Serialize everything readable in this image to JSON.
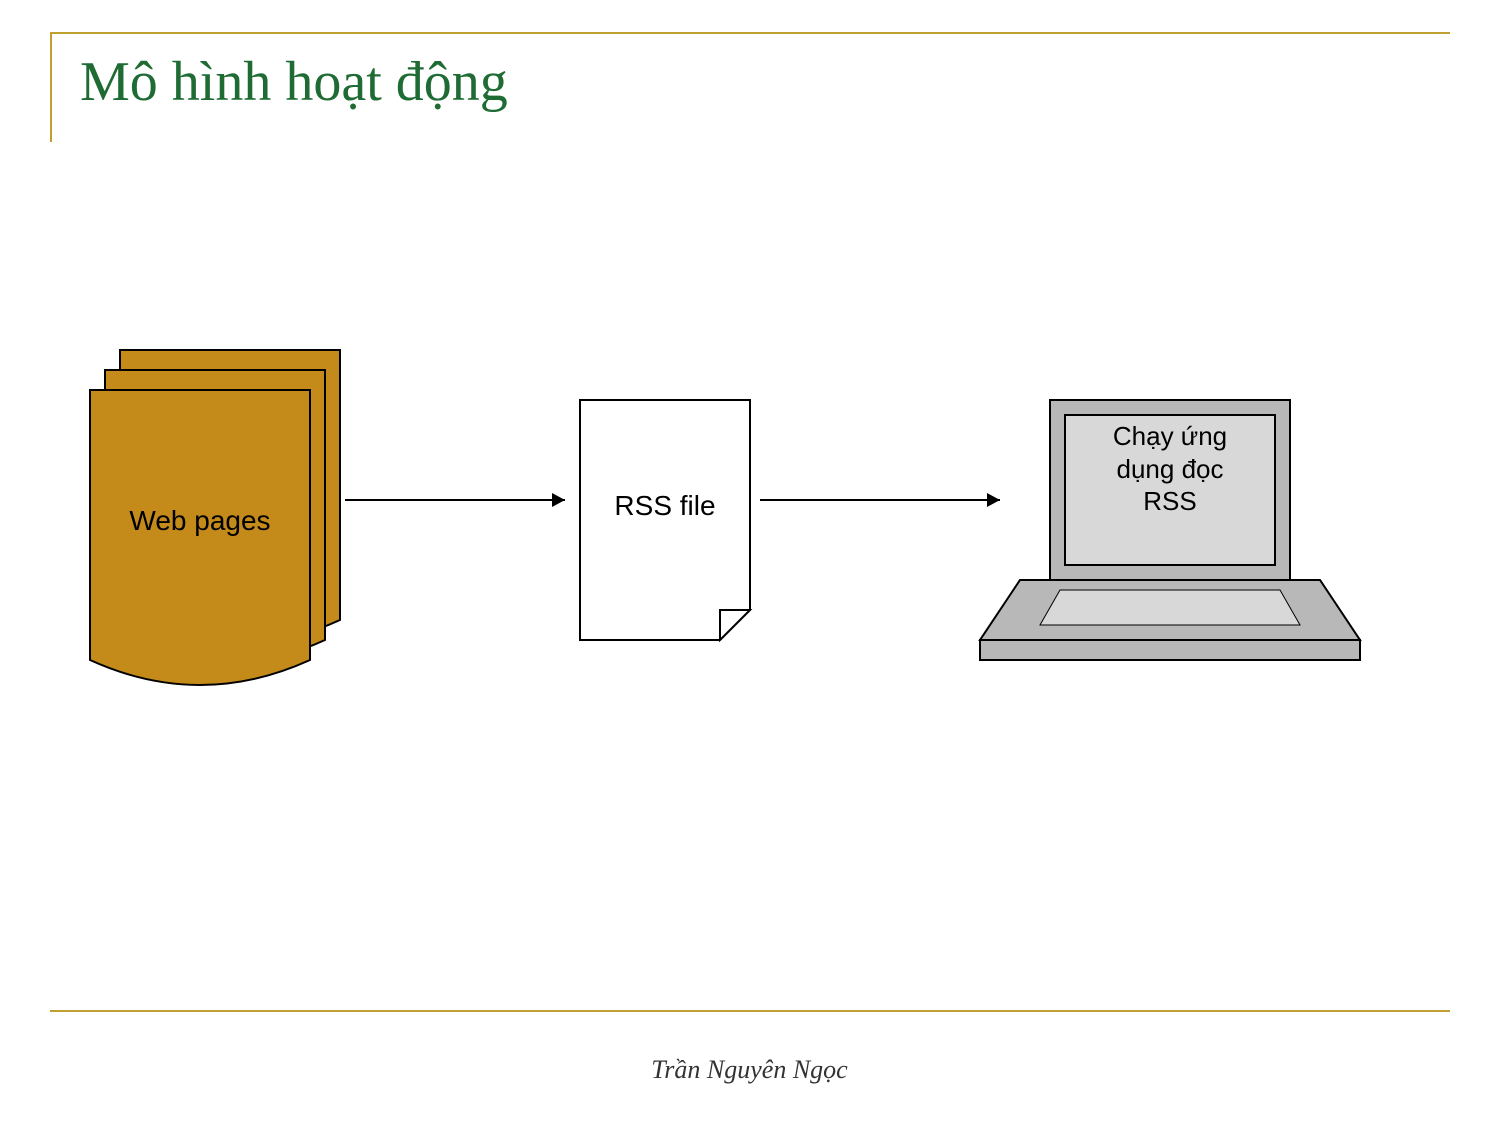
{
  "title": "Mô hình hoạt động",
  "author": "Trần Nguyên Ngọc",
  "nodes": {
    "web_pages": {
      "label": "Web pages"
    },
    "rss_file": {
      "label": "RSS file"
    },
    "laptop": {
      "label_line1": "Chạy ứng",
      "label_line2": "dụng đọc",
      "label_line3": "RSS"
    }
  },
  "colors": {
    "frame": "#c0a030",
    "title": "#1e6b33",
    "page_fill": "#c48a1a",
    "laptop_fill": "#b8b8b8",
    "laptop_screen": "#d8d8d8"
  }
}
